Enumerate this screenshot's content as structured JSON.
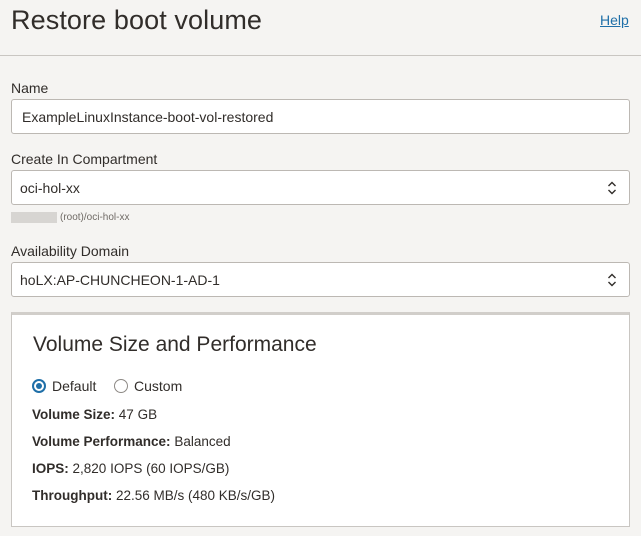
{
  "header": {
    "title": "Restore boot volume",
    "help_label": "Help"
  },
  "form": {
    "name": {
      "label": "Name",
      "value": "ExampleLinuxInstance-boot-vol-restored"
    },
    "compartment": {
      "label": "Create In Compartment",
      "value": "oci-hol-xx",
      "helper_path": "(root)/oci-hol-xx"
    },
    "availability_domain": {
      "label": "Availability Domain",
      "value": "hoLX:AP-CHUNCHEON-1-AD-1"
    }
  },
  "volume_panel": {
    "title": "Volume Size and Performance",
    "options": [
      {
        "label": "Default",
        "selected": true
      },
      {
        "label": "Custom",
        "selected": false
      }
    ],
    "details": [
      {
        "key": "Volume Size:",
        "value": "47 GB"
      },
      {
        "key": "Volume Performance:",
        "value": "Balanced"
      },
      {
        "key": "IOPS:",
        "value": "2,820 IOPS (60 IOPS/GB)"
      },
      {
        "key": "Throughput:",
        "value": "22.56 MB/s (480 KB/s/GB)"
      }
    ]
  },
  "colors": {
    "accent": "#1f6fa8",
    "background": "#f5f4f2",
    "text": "#312d2a"
  }
}
